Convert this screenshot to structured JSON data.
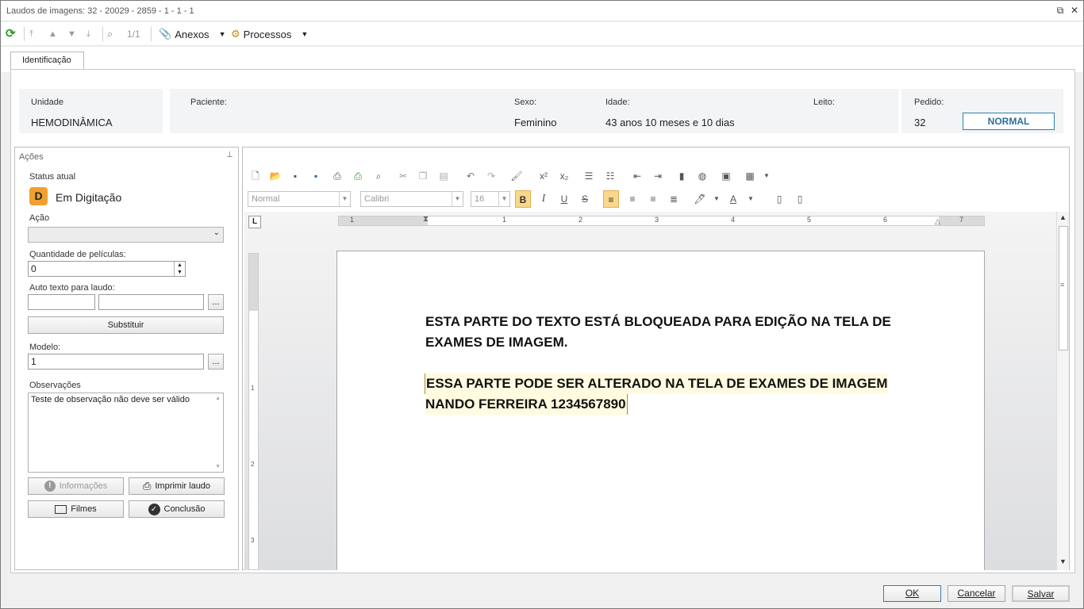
{
  "window": {
    "title": "Laudos de imagens: 32 - 20029 - 2859 - 1 - 1 - 1"
  },
  "toolbar": {
    "record_counter": "1/1",
    "anexos_label": "Anexos",
    "processos_label": "Processos"
  },
  "tabs": [
    {
      "label": "Identificação"
    }
  ],
  "info": {
    "unidade_label": "Unidade",
    "unidade_value": "HEMODINÂMICA",
    "paciente_label": "Paciente:",
    "paciente_value": "",
    "sexo_label": "Sexo:",
    "sexo_value": "Feminino",
    "idade_label": "Idade:",
    "idade_value": "43 anos 10 meses  e 10 dias",
    "leito_label": "Leito:",
    "leito_value": "",
    "pedido_label": "Pedido:",
    "pedido_value": "32",
    "priority_badge": "NORMAL"
  },
  "acoes": {
    "title": "Ações",
    "status_label": "Status atual",
    "status_letter": "D",
    "status_value": "Em Digitação",
    "acao_label": "Ação",
    "acao_value": "",
    "quantidade_label": "Quantidade de películas:",
    "quantidade_value": "0",
    "auto_texto_label": "Auto texto para laudo:",
    "auto_texto_code": "",
    "auto_texto_desc": "",
    "browse_label": "...",
    "substituir_label": "Substituir",
    "modelo_label": "Modelo:",
    "modelo_value": "1",
    "observacoes_label": "Observações",
    "observacoes_value": "Teste de observação não deve ser válido",
    "btn_informacoes": "Informações",
    "btn_imprimir": "Imprimir laudo",
    "btn_filmes": "Filmes",
    "btn_conclusao": "Conclusão"
  },
  "editor": {
    "style_value": "Normal",
    "font_value": "Calibri",
    "size_value": "16",
    "bold_label": "B",
    "italic_label": "I",
    "underline_label": "U",
    "strike_label": "S",
    "superscript_label": "x²",
    "subscript_label": "x₂",
    "color_label": "A",
    "ruler_corner": "L",
    "ruler_numbers": [
      "1",
      "1",
      "2",
      "3",
      "4",
      "5",
      "6",
      "7"
    ],
    "vruler_numbers": [
      "1",
      "2",
      "3"
    ],
    "locked_text_line1": "ESTA PARTE DO TEXTO ESTÁ BLOQUEADA PARA EDIÇÃO NA TELA DE",
    "locked_text_line2": "EXAMES DE IMAGEM.",
    "editable_text_line1": "ESSA PARTE PODE SER ALTERADO NA TELA DE EXAMES DE IMAGEM",
    "editable_text_line2": "NANDO FERREIRA 1234567890"
  },
  "footer": {
    "ok_label": "OK",
    "cancelar_label": "Cancelar",
    "salvar_label": "Salvar"
  },
  "colors": {
    "accent": "#2e80ad",
    "status_badge": "#f0a030",
    "highlight": "#fffbe0"
  }
}
